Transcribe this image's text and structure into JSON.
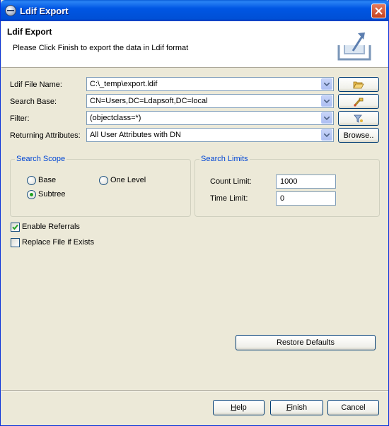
{
  "window": {
    "title": "Ldif Export"
  },
  "header": {
    "title": "Ldif Export",
    "description": "Please Click Finish to export the data in Ldif format"
  },
  "form": {
    "file_name": {
      "label": "Ldif File Name:",
      "value": "C:\\_temp\\export.ldif",
      "button_icon": "folder-open-icon"
    },
    "search_base": {
      "label": "Search Base:",
      "value": "CN=Users,DC=Ldapsoft,DC=local",
      "button_icon": "browse-tree-icon"
    },
    "filter": {
      "label": "Filter:",
      "value": "(objectclass=*)",
      "button_icon": "filter-icon"
    },
    "returning_attributes": {
      "label": "Returning Attributes:",
      "value": "All User Attributes with DN",
      "button_label": "Browse.."
    }
  },
  "search_scope": {
    "title": "Search Scope",
    "options": {
      "base": "Base",
      "one_level": "One Level",
      "subtree": "Subtree"
    },
    "selected": "Subtree"
  },
  "search_limits": {
    "title": "Search Limits",
    "count_limit_label": "Count Limit:",
    "count_limit": "1000",
    "time_limit_label": "Time Limit:",
    "time_limit": "0"
  },
  "options": {
    "enable_referrals": {
      "label": "Enable Referrals",
      "checked": true
    },
    "replace_file": {
      "label": "Replace File if Exists",
      "checked": false
    }
  },
  "buttons": {
    "restore_defaults": "Restore Defaults",
    "help": "Help",
    "finish": "Finish",
    "cancel": "Cancel"
  }
}
